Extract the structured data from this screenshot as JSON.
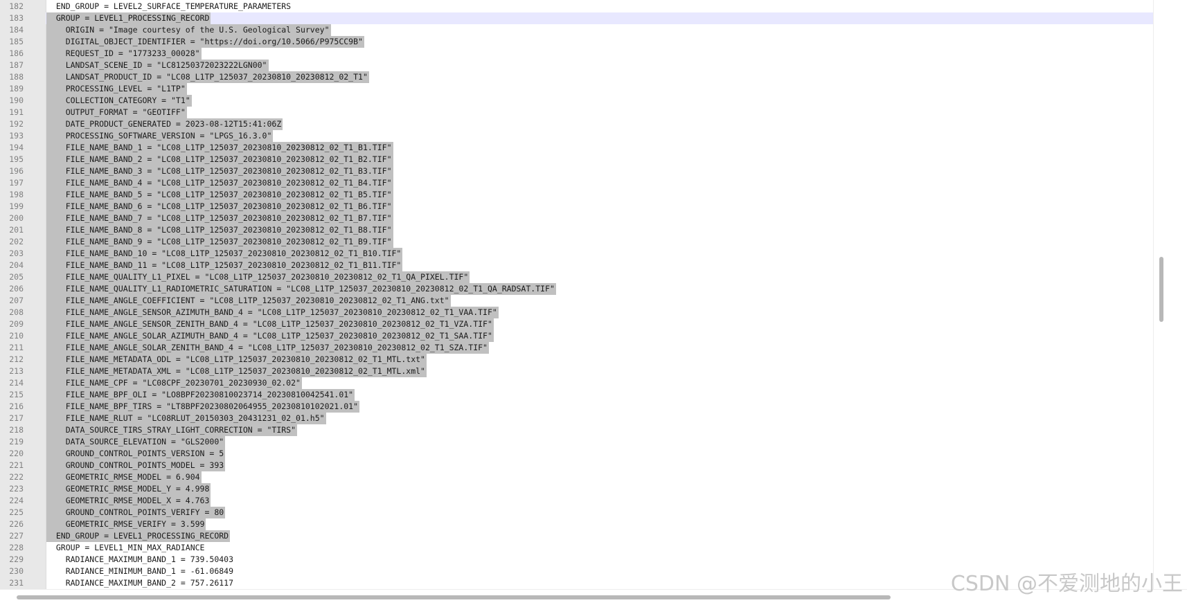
{
  "editor": {
    "current_line": 183,
    "lines": [
      {
        "n": "182",
        "text": "  END_GROUP = LEVEL2_SURFACE_TEMPERATURE_PARAMETERS",
        "sel": false
      },
      {
        "n": "183",
        "text": "  GROUP = LEVEL1_PROCESSING_RECORD",
        "sel": true
      },
      {
        "n": "184",
        "text": "    ORIGIN = \"Image courtesy of the U.S. Geological Survey\"",
        "sel": true
      },
      {
        "n": "185",
        "text": "    DIGITAL_OBJECT_IDENTIFIER = \"https://doi.org/10.5066/P975CC9B\"",
        "sel": true
      },
      {
        "n": "186",
        "text": "    REQUEST_ID = \"1773233_00028\"",
        "sel": true
      },
      {
        "n": "187",
        "text": "    LANDSAT_SCENE_ID = \"LC81250372023222LGN00\"",
        "sel": true
      },
      {
        "n": "188",
        "text": "    LANDSAT_PRODUCT_ID = \"LC08_L1TP_125037_20230810_20230812_02_T1\"",
        "sel": true
      },
      {
        "n": "189",
        "text": "    PROCESSING_LEVEL = \"L1TP\"",
        "sel": true
      },
      {
        "n": "190",
        "text": "    COLLECTION_CATEGORY = \"T1\"",
        "sel": true
      },
      {
        "n": "191",
        "text": "    OUTPUT_FORMAT = \"GEOTIFF\"",
        "sel": true
      },
      {
        "n": "192",
        "text": "    DATE_PRODUCT_GENERATED = 2023-08-12T15:41:06Z",
        "sel": true
      },
      {
        "n": "193",
        "text": "    PROCESSING_SOFTWARE_VERSION = \"LPGS_16.3.0\"",
        "sel": true
      },
      {
        "n": "194",
        "text": "    FILE_NAME_BAND_1 = \"LC08_L1TP_125037_20230810_20230812_02_T1_B1.TIF\"",
        "sel": true
      },
      {
        "n": "195",
        "text": "    FILE_NAME_BAND_2 = \"LC08_L1TP_125037_20230810_20230812_02_T1_B2.TIF\"",
        "sel": true
      },
      {
        "n": "196",
        "text": "    FILE_NAME_BAND_3 = \"LC08_L1TP_125037_20230810_20230812_02_T1_B3.TIF\"",
        "sel": true
      },
      {
        "n": "197",
        "text": "    FILE_NAME_BAND_4 = \"LC08_L1TP_125037_20230810_20230812_02_T1_B4.TIF\"",
        "sel": true
      },
      {
        "n": "198",
        "text": "    FILE_NAME_BAND_5 = \"LC08_L1TP_125037_20230810_20230812_02_T1_B5.TIF\"",
        "sel": true
      },
      {
        "n": "199",
        "text": "    FILE_NAME_BAND_6 = \"LC08_L1TP_125037_20230810_20230812_02_T1_B6.TIF\"",
        "sel": true
      },
      {
        "n": "200",
        "text": "    FILE_NAME_BAND_7 = \"LC08_L1TP_125037_20230810_20230812_02_T1_B7.TIF\"",
        "sel": true
      },
      {
        "n": "201",
        "text": "    FILE_NAME_BAND_8 = \"LC08_L1TP_125037_20230810_20230812_02_T1_B8.TIF\"",
        "sel": true
      },
      {
        "n": "202",
        "text": "    FILE_NAME_BAND_9 = \"LC08_L1TP_125037_20230810_20230812_02_T1_B9.TIF\"",
        "sel": true
      },
      {
        "n": "203",
        "text": "    FILE_NAME_BAND_10 = \"LC08_L1TP_125037_20230810_20230812_02_T1_B10.TIF\"",
        "sel": true
      },
      {
        "n": "204",
        "text": "    FILE_NAME_BAND_11 = \"LC08_L1TP_125037_20230810_20230812_02_T1_B11.TIF\"",
        "sel": true
      },
      {
        "n": "205",
        "text": "    FILE_NAME_QUALITY_L1_PIXEL = \"LC08_L1TP_125037_20230810_20230812_02_T1_QA_PIXEL.TIF\"",
        "sel": true
      },
      {
        "n": "206",
        "text": "    FILE_NAME_QUALITY_L1_RADIOMETRIC_SATURATION = \"LC08_L1TP_125037_20230810_20230812_02_T1_QA_RADSAT.TIF\"",
        "sel": true
      },
      {
        "n": "207",
        "text": "    FILE_NAME_ANGLE_COEFFICIENT = \"LC08_L1TP_125037_20230810_20230812_02_T1_ANG.txt\"",
        "sel": true
      },
      {
        "n": "208",
        "text": "    FILE_NAME_ANGLE_SENSOR_AZIMUTH_BAND_4 = \"LC08_L1TP_125037_20230810_20230812_02_T1_VAA.TIF\"",
        "sel": true
      },
      {
        "n": "209",
        "text": "    FILE_NAME_ANGLE_SENSOR_ZENITH_BAND_4 = \"LC08_L1TP_125037_20230810_20230812_02_T1_VZA.TIF\"",
        "sel": true
      },
      {
        "n": "210",
        "text": "    FILE_NAME_ANGLE_SOLAR_AZIMUTH_BAND_4 = \"LC08_L1TP_125037_20230810_20230812_02_T1_SAA.TIF\"",
        "sel": true
      },
      {
        "n": "211",
        "text": "    FILE_NAME_ANGLE_SOLAR_ZENITH_BAND_4 = \"LC08_L1TP_125037_20230810_20230812_02_T1_SZA.TIF\"",
        "sel": true
      },
      {
        "n": "212",
        "text": "    FILE_NAME_METADATA_ODL = \"LC08_L1TP_125037_20230810_20230812_02_T1_MTL.txt\"",
        "sel": true
      },
      {
        "n": "213",
        "text": "    FILE_NAME_METADATA_XML = \"LC08_L1TP_125037_20230810_20230812_02_T1_MTL.xml\"",
        "sel": true
      },
      {
        "n": "214",
        "text": "    FILE_NAME_CPF = \"LC08CPF_20230701_20230930_02.02\"",
        "sel": true
      },
      {
        "n": "215",
        "text": "    FILE_NAME_BPF_OLI = \"LO8BPF20230810023714_20230810042541.01\"",
        "sel": true
      },
      {
        "n": "216",
        "text": "    FILE_NAME_BPF_TIRS = \"LT8BPF20230802064955_20230810102021.01\"",
        "sel": true
      },
      {
        "n": "217",
        "text": "    FILE_NAME_RLUT = \"LC08RLUT_20150303_20431231_02_01.h5\"",
        "sel": true
      },
      {
        "n": "218",
        "text": "    DATA_SOURCE_TIRS_STRAY_LIGHT_CORRECTION = \"TIRS\"",
        "sel": true
      },
      {
        "n": "219",
        "text": "    DATA_SOURCE_ELEVATION = \"GLS2000\"",
        "sel": true
      },
      {
        "n": "220",
        "text": "    GROUND_CONTROL_POINTS_VERSION = 5",
        "sel": true
      },
      {
        "n": "221",
        "text": "    GROUND_CONTROL_POINTS_MODEL = 393",
        "sel": true
      },
      {
        "n": "222",
        "text": "    GEOMETRIC_RMSE_MODEL = 6.904",
        "sel": true
      },
      {
        "n": "223",
        "text": "    GEOMETRIC_RMSE_MODEL_Y = 4.998",
        "sel": true
      },
      {
        "n": "224",
        "text": "    GEOMETRIC_RMSE_MODEL_X = 4.763",
        "sel": true
      },
      {
        "n": "225",
        "text": "    GROUND_CONTROL_POINTS_VERIFY = 80",
        "sel": true
      },
      {
        "n": "226",
        "text": "    GEOMETRIC_RMSE_VERIFY = 3.599",
        "sel": true
      },
      {
        "n": "227",
        "text": "  END_GROUP = LEVEL1_PROCESSING_RECORD",
        "sel": true
      },
      {
        "n": "228",
        "text": "  GROUP = LEVEL1_MIN_MAX_RADIANCE",
        "sel": false
      },
      {
        "n": "229",
        "text": "    RADIANCE_MAXIMUM_BAND_1 = 739.50403",
        "sel": false
      },
      {
        "n": "230",
        "text": "    RADIANCE_MINIMUM_BAND_1 = -61.06849",
        "sel": false
      },
      {
        "n": "231",
        "text": "    RADIANCE_MAXIMUM_BAND_2 = 757.26117",
        "sel": false
      }
    ]
  },
  "scrollbars": {
    "vertical_position": 0.49,
    "vertical_visible_fraction": 0.11,
    "horizontal_visible_fraction": 0.75
  },
  "watermark": "CSDN @不爱测地的小王",
  "colors": {
    "selection": "#c0c0c0",
    "current_line": "#e8e8ff",
    "gutter": "#e8e8e8",
    "line_number": "#808080"
  }
}
